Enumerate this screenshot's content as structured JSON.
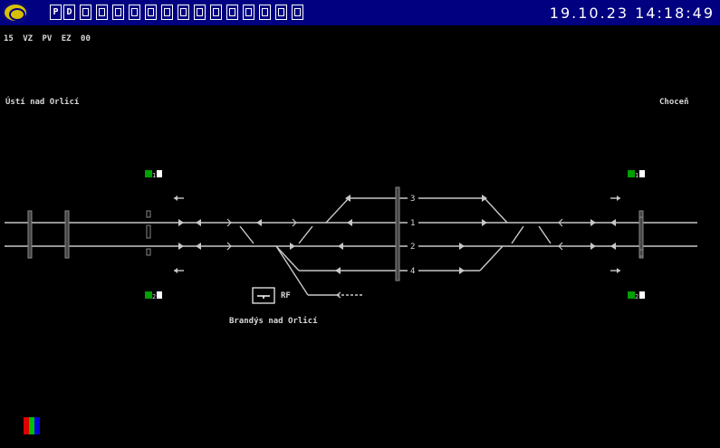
{
  "toolbar": {
    "logo": "railway-logo-icon",
    "buttons": [
      {
        "label": "P",
        "icon": "p-icon"
      },
      {
        "label": "D",
        "icon": "d-icon"
      },
      {
        "label": "",
        "icon": "scan-icon"
      },
      {
        "label": "",
        "icon": "list-icon"
      },
      {
        "label": "",
        "icon": "doc-icon"
      },
      {
        "label": "",
        "icon": "doc-arrow-icon"
      },
      {
        "label": "",
        "icon": "panel-icon"
      },
      {
        "label": "",
        "icon": "cross-icon"
      },
      {
        "label": "",
        "icon": "device-icon"
      },
      {
        "label": "",
        "icon": "expand-icon"
      },
      {
        "label": "",
        "icon": "monitor-icon"
      },
      {
        "label": "",
        "icon": "copy-icon"
      },
      {
        "label": "",
        "icon": "layers-icon"
      },
      {
        "label": "",
        "icon": "window-icon"
      },
      {
        "label": "",
        "icon": "save-icon"
      },
      {
        "label": "",
        "icon": "upload-icon"
      }
    ],
    "clock": "19.10.23  14:18:49"
  },
  "status_line": "15 VZ PV EZ 00",
  "stations": {
    "left": "Ústí nad Orlicí",
    "right": "Choceň",
    "center": "Brandýs nad Orlicí"
  },
  "track_numbers": [
    "3",
    "1",
    "2",
    "4"
  ],
  "signal_numbers": {
    "left_top": "1",
    "left_bottom": "2",
    "right_top": "1",
    "right_bottom": "2"
  },
  "rf_label": "RF",
  "colors": {
    "topbar": "#000080",
    "track": "#c8c8c8",
    "signal_green": "#00a000",
    "background": "#000000"
  }
}
